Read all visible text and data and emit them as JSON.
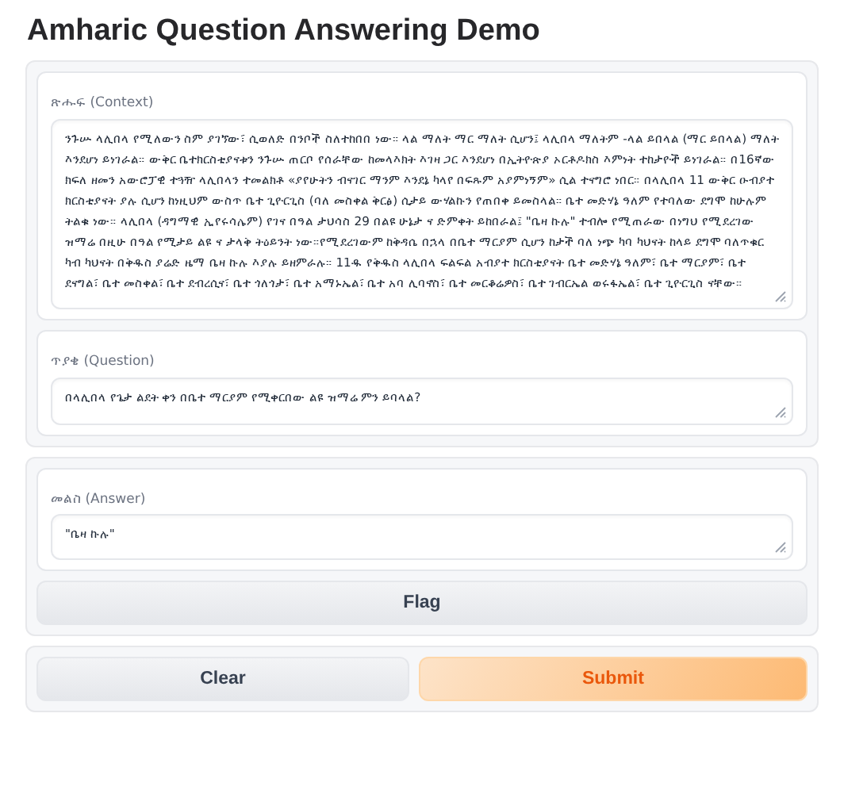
{
  "title": "Amharic Question Answering Demo",
  "inputs": [
    {
      "label": "ጽሑፍ (Context)",
      "value": "ንጉሡ ላሊበላ የሚለውን ስም ያገኘው፣ ሲወለድ በንቦች ስለተከበበ ነው። ላል ማለት ማር ማለት ሲሆን፤ ላሊበላ ማለትም -ላል ይበላል (ማር ይበላል) ማለት እንደሆነ ይነገራል። ውቅር ቤተክርስቲያናቱን ንጉሡ ጠርቦ የሰራቸው ከመላእክት እገዛ ጋር እንደሆነ በኢትዮጵያ ኦርቶዶክስ እምነት ተከታዮች ይነገራል። በ16ኛው ክፍለ ዘመን አውሮፓዊ ተጓዥ ላሊበላን ተመልክቶ «ያየሁትን ብናገር ማንም እንደኔ ካላየ በፍጹም አያምነኝም» ሲል ተናግሮ ነበር። በላሊበላ 11 ውቅር ዑብያተ ክርስቲያናት ያሉ ሲሆን ከነዚህም ውስጥ ቤተ ጊዮርጊስ (ባለ መስቀል ቅርፅ) ሲታይ ውሃልኩን የጠበቀ ይመስላል። ቤተ መድሃኔ ዓለም የተባለው ደግሞ ከሁሉም ትልቁ ነው። ላሊበላ (ዳግማዊ ኢየሩሳሌም) የገና በዓል ታህሳስ 29 በልዩ ሁኔታ ና ድምቀት ይከበራል፤ \"ቤዛ ኩሉ\" ተብሎ የሚጠራው በነግህ የሚደረገው ዝማሬ በዚሁ በዓል የሚታይ ልዩ ና ታላቅ ትዕይንት ነው።የሚደረገውም ከቅዳሴ በኋላ በቤተ ማርያም ሲሆን ከታች ባለ ነጭ ካባ ካህናት ከላይ ደግሞ ባለጥቁር ካብ ካህናት በቅዱስ ያሬድ ዜማ ቤዛ ኩሉ እያሉ ይዘምራሉ። 11ዱ የቅዱስ ላሊበላ ፍልፍል አብያተ ክርስቲያናት ቤተ መድሃኔ ዓለም፣ ቤተ ማርያም፣ ቤተ ደናግል፣ ቤተ መስቀል፣ ቤተ ደብረሲና፣ ቤተ ጎለጎታ፣ ቤተ አማኑኤል፣ ቤተ አባ ሊባኖስ፣ ቤተ መርቆሬዎስ፣ ቤተ ገብርኤል ወሩፋኤል፣ ቤተ ጊዮርጊስ ናቸው።"
    },
    {
      "label": "ጥያቄ (Question)",
      "value": "በላሊበላ የጌታ ልደት ቀን በቤተ ማርያም የሚቀርበው ልዩ ዝማሬ ምን ይባላል?"
    }
  ],
  "output": {
    "label": "መልስ (Answer)",
    "value": "\"ቤዛ ኩሉ\""
  },
  "flag_button": "Flag",
  "actions": [
    {
      "label": "Clear",
      "kind": "secondary"
    },
    {
      "label": "Submit",
      "kind": "primary"
    }
  ]
}
